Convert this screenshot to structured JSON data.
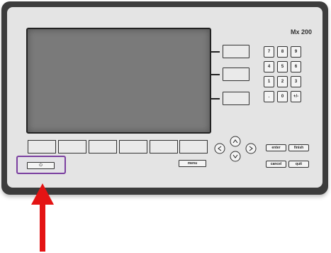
{
  "device": {
    "model_label": "Mx 200",
    "numpad": [
      "7",
      "8",
      "9",
      "4",
      "5",
      "6",
      "1",
      "2",
      "3",
      ".",
      "0",
      "+/-"
    ],
    "menu_label": "menu",
    "enter_label": "enter",
    "finish_label": "finish",
    "cancel_label": "cancel",
    "quit_label": "quit",
    "power_symbol": "⏻"
  },
  "colors": {
    "highlight": "#7b3fa0",
    "pointer_arrow": "#e41414"
  }
}
